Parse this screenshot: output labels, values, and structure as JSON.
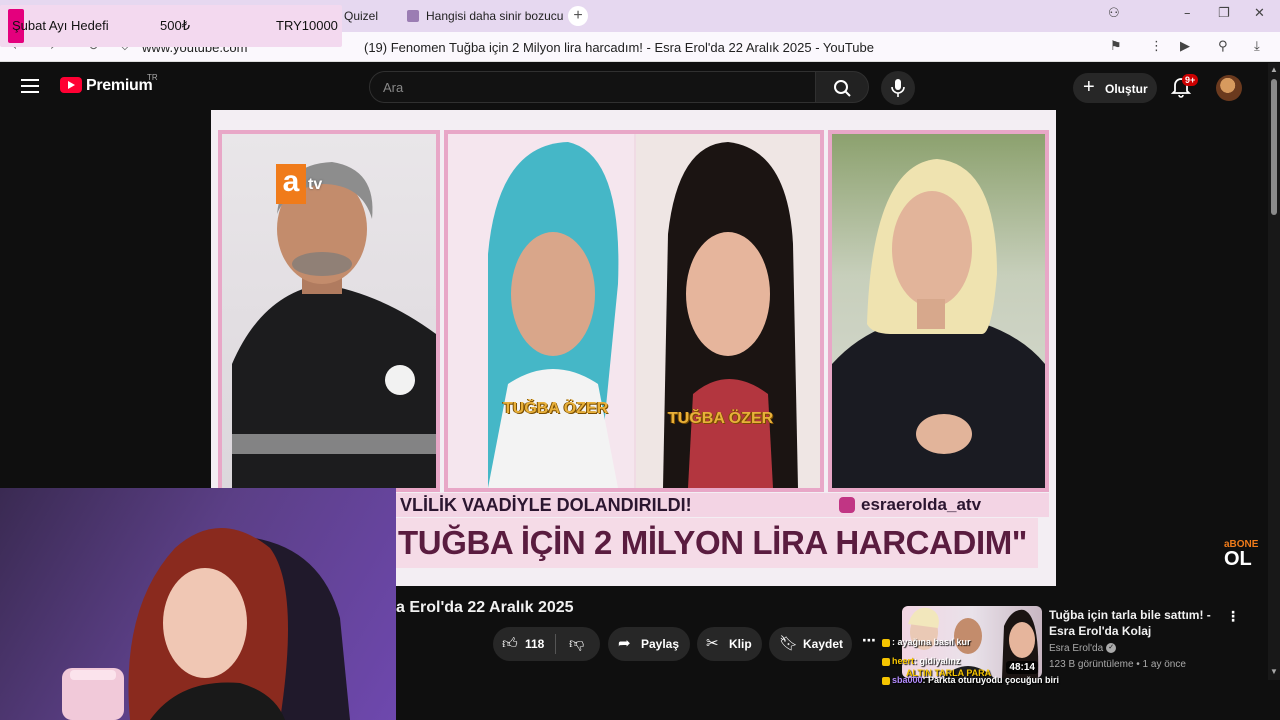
{
  "browser": {
    "tabs": [
      {
        "label": "Quizel"
      },
      {
        "label": "Hangisi daha sinir bozucu"
      }
    ],
    "url": "www.youtube.com",
    "page_title": "(19) Fenomen Tuğba için 2 Milyon lira harcadım! - Esra Erol'da 22 Aralık 2025 - YouTube"
  },
  "goal_widget": {
    "label": "Şubat Ayı Hedefi",
    "current": "500₺",
    "target": "TRY10000"
  },
  "header": {
    "brand": "Premium",
    "region": "TR",
    "search_placeholder": "Ara",
    "create_label": "Oluştur",
    "notifications_badge": "9+"
  },
  "video": {
    "channel_logo_letter": "a",
    "channel_logo_text": "tv",
    "name_tag_1": "TUĞBA ÖZER",
    "name_tag_2": "TUĞBA ÖZER",
    "banner_top": "VLİLİK VAADİYLE DOLANDIRILDI!",
    "banner_handle": "esraerolda_atv",
    "banner_main": "TUĞBA İÇİN 2 MİLYON LİRA HARCADIM\"",
    "corner_logo_top": "aBONE",
    "corner_logo_bottom": "OL"
  },
  "below_video": {
    "title": "a Erol'da 22 Aralık 2025",
    "like_count": "118",
    "share_label": "Paylaş",
    "clip_label": "Klip",
    "save_label": "Kaydet"
  },
  "recommendation": {
    "title": "Tuğba için tarla bile sattım! - Esra Erol'da Kolaj",
    "channel": "Esra Erol'da",
    "meta": "123 B görüntüleme • 1 ay önce",
    "duration": "48:14"
  },
  "chat": [
    {
      "user": "",
      "text": ": ayağına basıl kur"
    },
    {
      "user": "heert",
      "text": ": gidiyalınz"
    },
    {
      "user": "",
      "text": "ALTIN TARLA PARA"
    },
    {
      "user": "sba000",
      "text": ": Parkta oturuyodu çocuğun biri"
    }
  ],
  "colors": {
    "accent": "#ff0033",
    "goal_pin": "#e4007d",
    "banner_text": "#5a1c3f"
  }
}
